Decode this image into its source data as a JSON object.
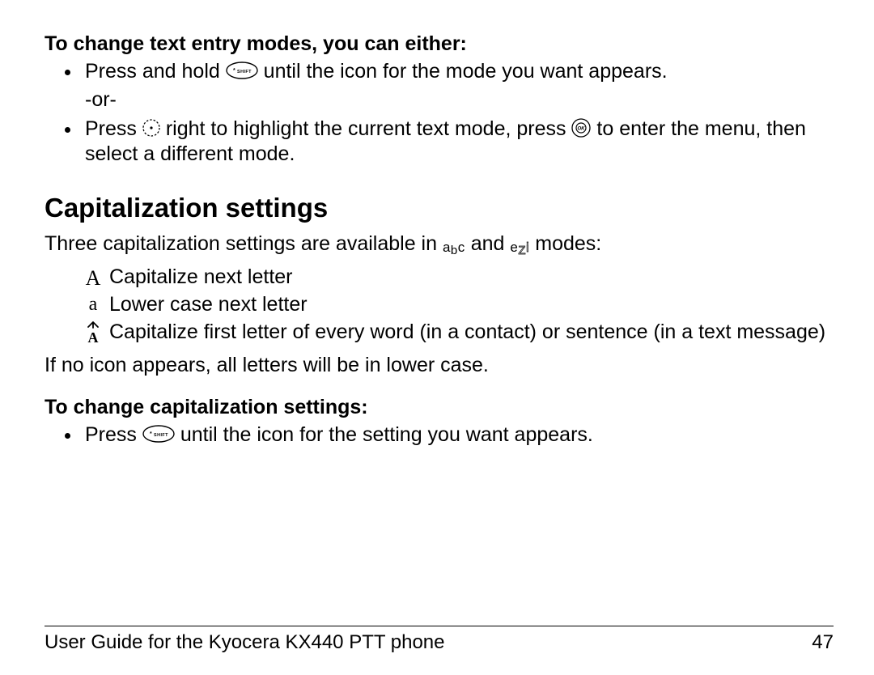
{
  "headings": {
    "change_modes": "To change text entry modes, you can either:",
    "capitalization": "Capitalization settings",
    "change_cap": "To change capitalization settings:"
  },
  "mode_change": {
    "item1_a": "Press and hold ",
    "item1_b": " until the icon for the mode you want appears.",
    "item1_or": "-or-",
    "item2_a": "Press ",
    "item2_b": " right to highlight the current text mode, press ",
    "item2_c": " to enter the menu, then select a different mode."
  },
  "cap": {
    "intro_a": "Three capitalization settings are available in ",
    "intro_b": " and ",
    "intro_c": " modes:",
    "row1": "Capitalize next letter",
    "row2": "Lower case next letter",
    "row3": "Capitalize first letter of every word (in a contact) or sentence (in a text message)",
    "note": "If no icon appears, all letters will be in lower case."
  },
  "cap_change": {
    "item1_a": "Press ",
    "item1_b": " until the icon for the setting you want appears."
  },
  "modes": {
    "abc_a": "a",
    "abc_b": "b",
    "abc_c": "c",
    "ezi_e": "e",
    "ezi_z": "Z",
    "ezi_i": "i"
  },
  "symbols": {
    "upper_A": "A",
    "lower_a": "a"
  },
  "footer": {
    "left": "User Guide for the Kyocera KX440 PTT phone",
    "right": "47"
  }
}
